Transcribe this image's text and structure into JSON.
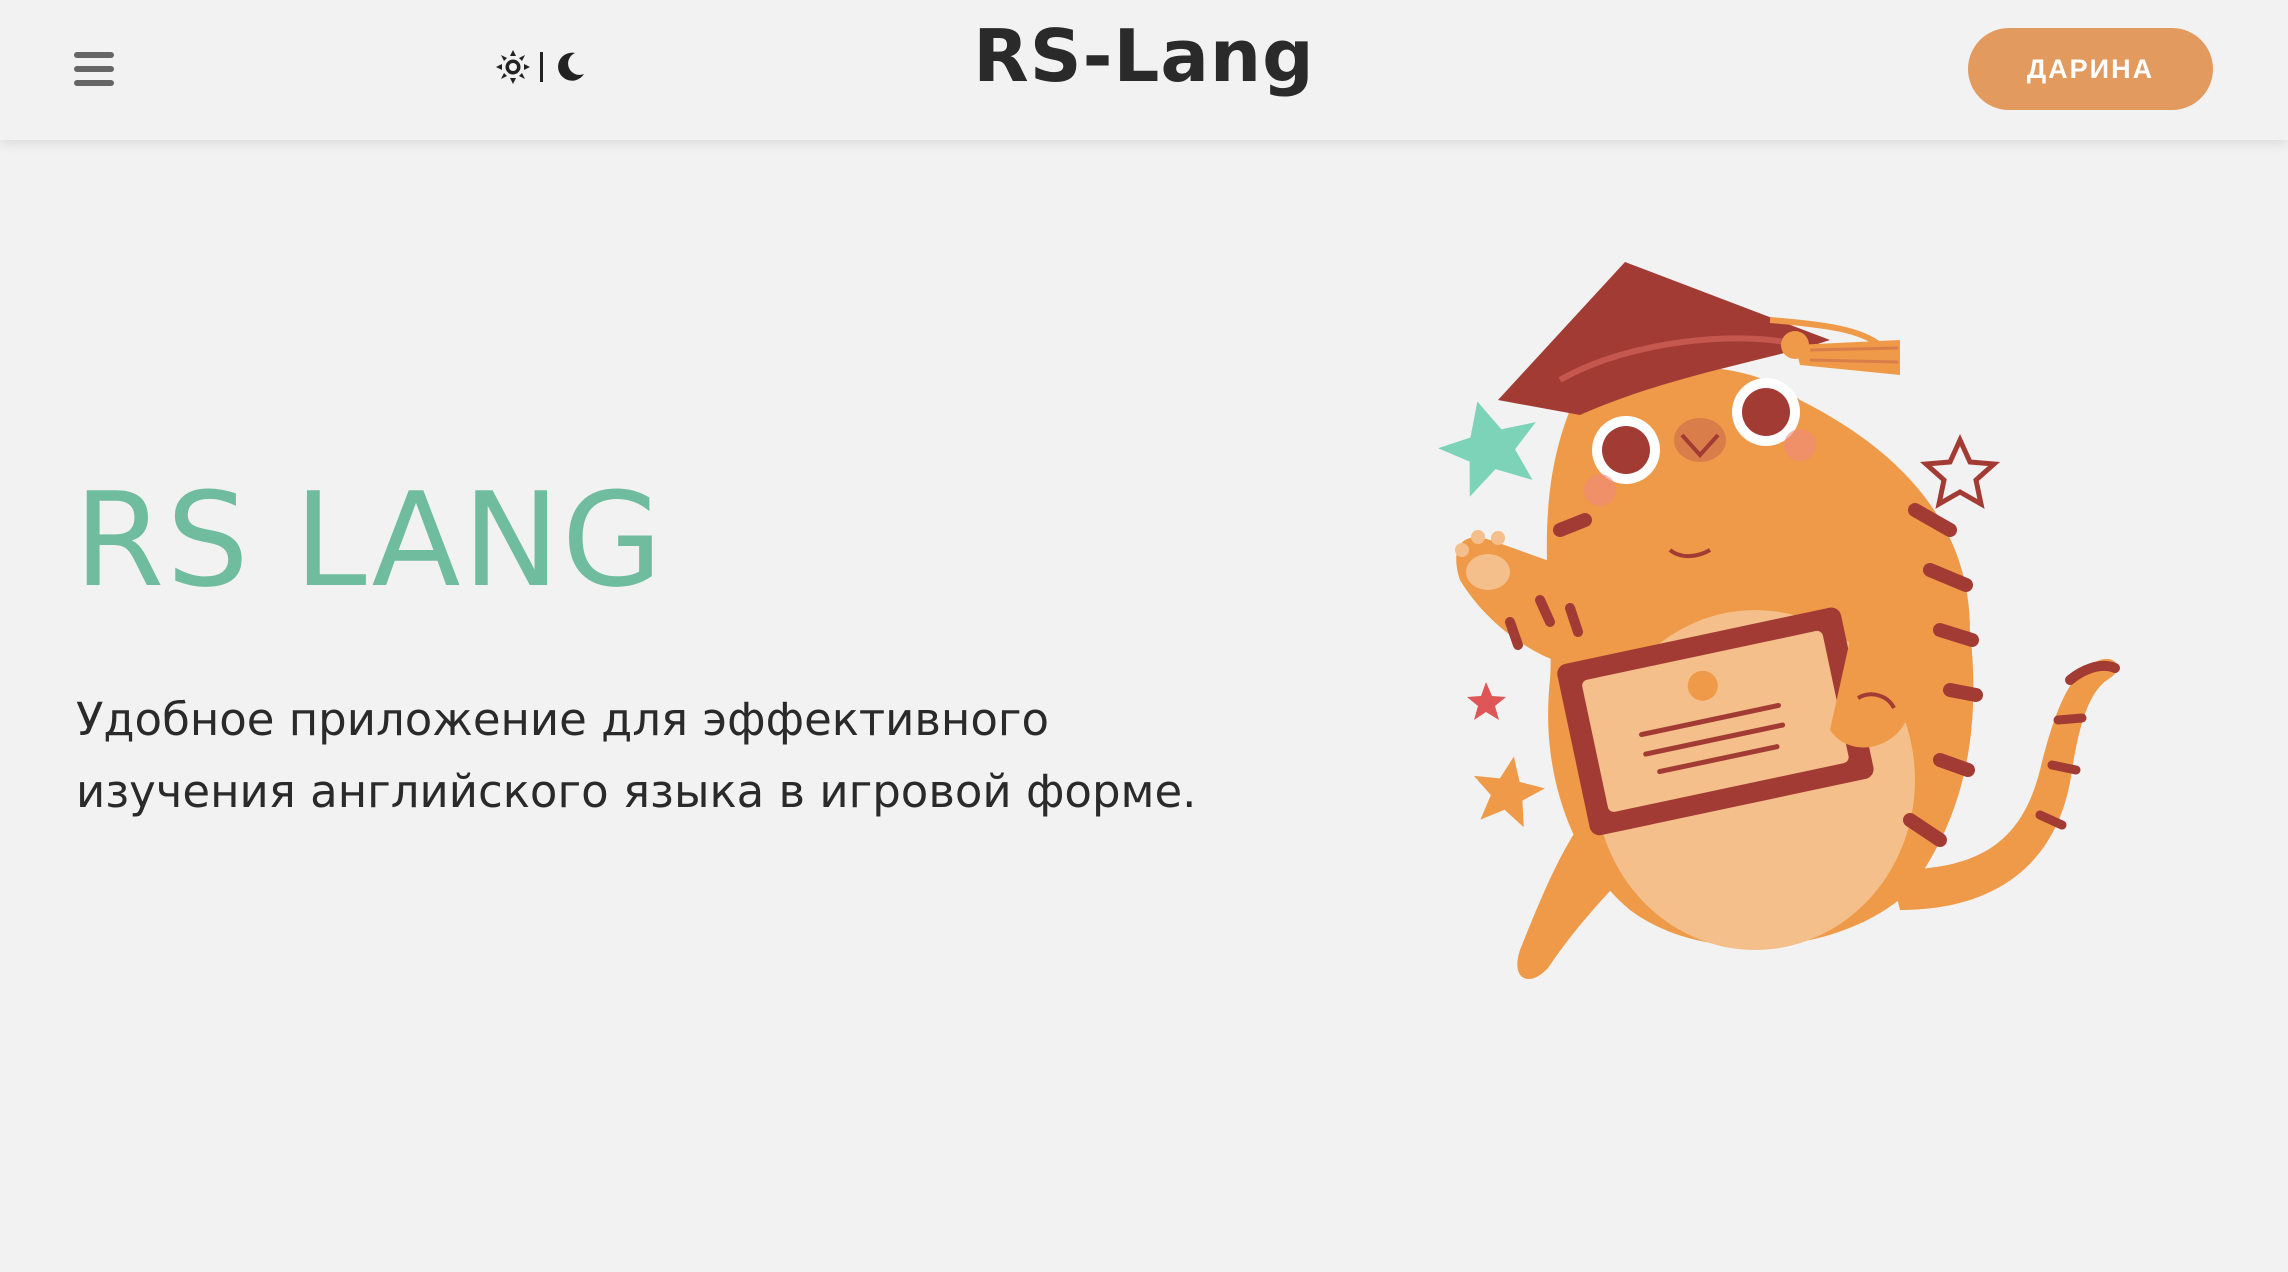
{
  "header": {
    "menu_icon": "hamburger-menu-icon",
    "theme_toggle": {
      "light_icon": "sun-icon",
      "separator": "|",
      "dark_icon": "moon-icon"
    },
    "title": "RS-Lang",
    "user_button_label": "ДАРИНА"
  },
  "hero": {
    "title": "RS LANG",
    "description_line1": "Удобное приложение для эффективного",
    "description_line2": "изучения английского языка в игровой форме.",
    "illustration": "graduate-cat-illustration"
  },
  "colors": {
    "background": "#f2f2f2",
    "accent_green": "#6fbd9e",
    "accent_orange": "#e39a5e",
    "text_dark": "#2a2a2a"
  }
}
